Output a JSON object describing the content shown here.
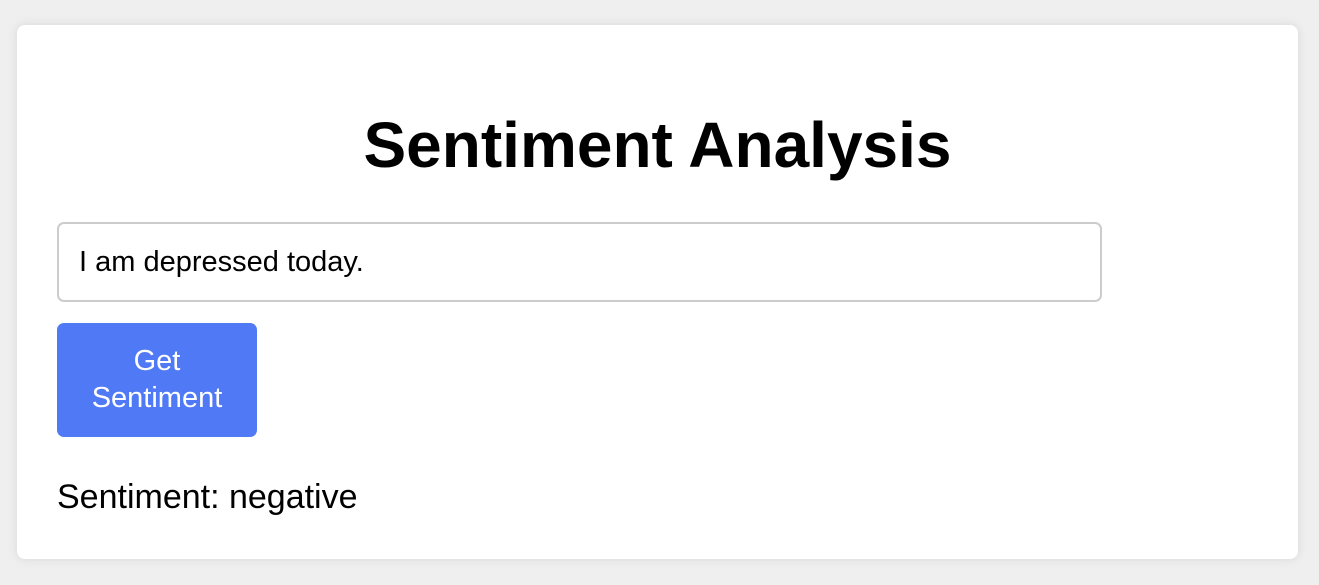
{
  "app": {
    "title": "Sentiment Analysis"
  },
  "form": {
    "input_value": "I am depressed today.",
    "submit_label": "Get Sentiment"
  },
  "result": {
    "text": "Sentiment: negative"
  },
  "colors": {
    "page_background": "#efefef",
    "card_background": "#ffffff",
    "button_background": "#5079f5",
    "button_text": "#ffffff",
    "input_border": "#cccccc"
  }
}
